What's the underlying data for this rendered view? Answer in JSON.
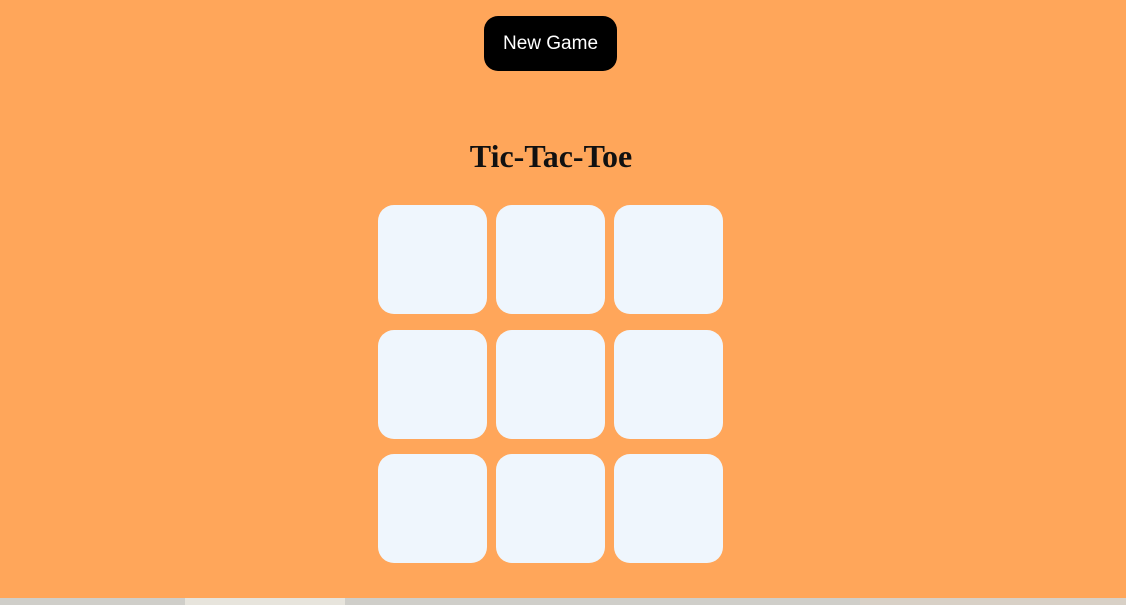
{
  "header": {
    "new_game_label": "New Game"
  },
  "title": "Tic-Tac-Toe",
  "board": {
    "cells": [
      "",
      "",
      "",
      "",
      "",
      "",
      "",
      "",
      ""
    ]
  },
  "colors": {
    "background": "#FFA65A",
    "button": "#000000",
    "button_text": "#ffffff",
    "cell": "#EFF6FD",
    "title": "#111111"
  }
}
